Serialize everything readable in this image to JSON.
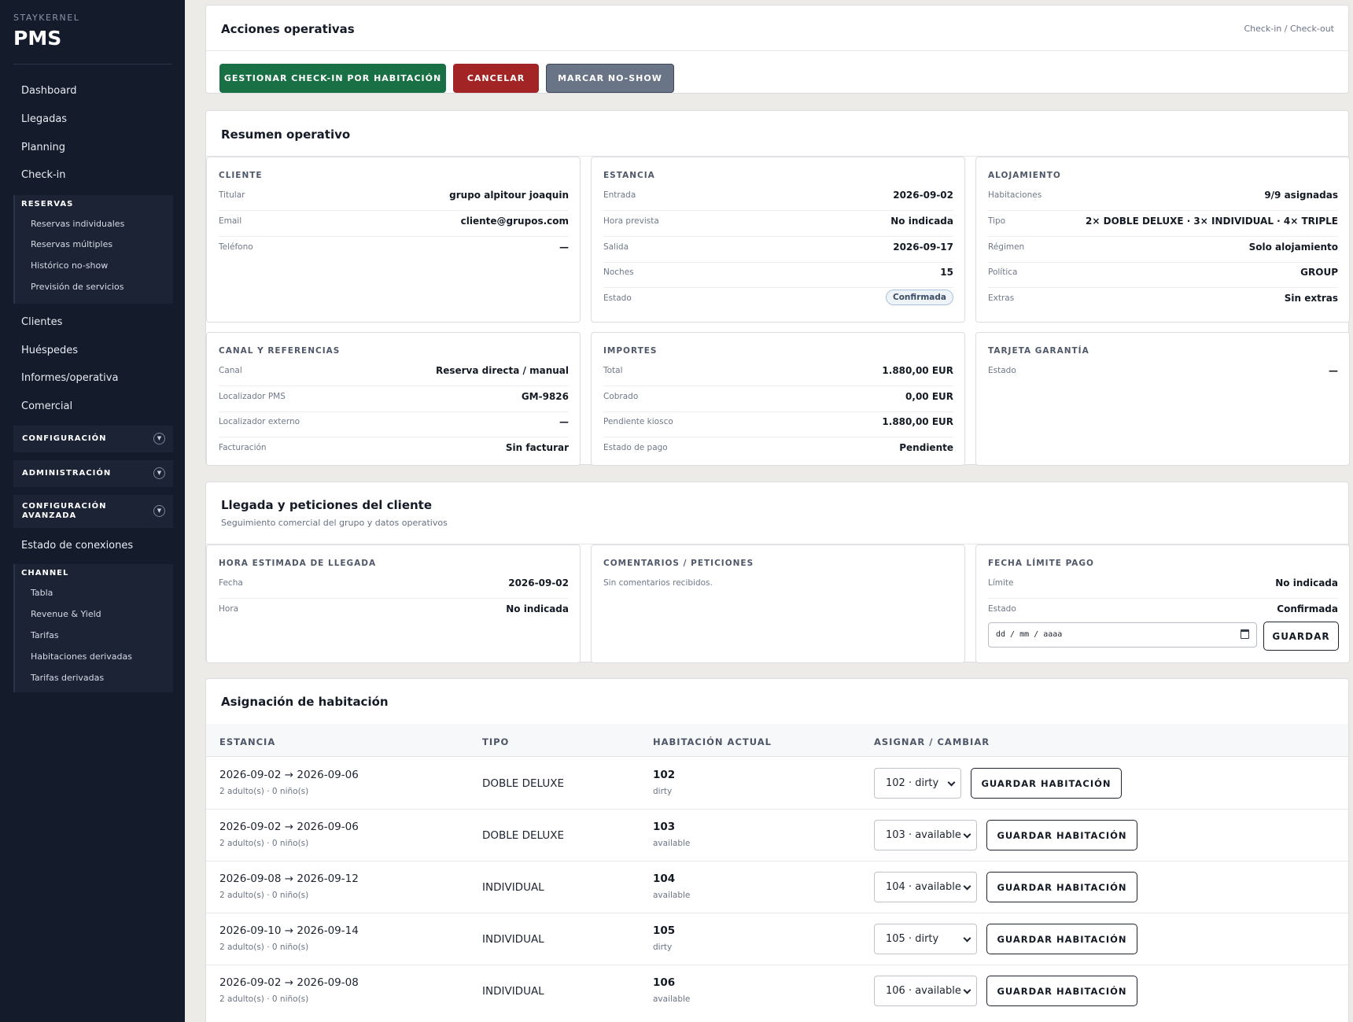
{
  "sidebar": {
    "brand_small": "STAYKERNEL",
    "brand_big": "PMS",
    "items": {
      "dashboard": "Dashboard",
      "llegadas": "Llegadas",
      "planning": "Planning",
      "checkin": "Check-in",
      "clientes": "Clientes",
      "huespedes": "Huéspedes",
      "informes": "Informes/operativa",
      "comercial": "Comercial",
      "estado_conexiones": "Estado de conexiones"
    },
    "reservas": {
      "title": "RESERVAS",
      "items": [
        "Reservas individuales",
        "Reservas múltiples",
        "Histórico no-show",
        "Previsión de servicios"
      ]
    },
    "configuracion": "CONFIGURACIÓN",
    "administracion": "ADMINISTRACIÓN",
    "configuracion_avanzada_1": "CONFIGURACIÓN",
    "configuracion_avanzada_2": "AVANZADA",
    "channel": {
      "title": "CHANNEL",
      "items": [
        "Tabla",
        "Revenue & Yield",
        "Tarifas",
        "Habitaciones derivadas",
        "Tarifas derivadas"
      ]
    }
  },
  "acciones": {
    "title": "Acciones operativas",
    "breadcrumb": "Check-in / Check-out",
    "btn_checkin": "GESTIONAR CHECK-IN POR HABITACIÓN",
    "btn_cancelar": "CANCELAR",
    "btn_noshow": "MARCAR NO-SHOW"
  },
  "resumen": {
    "title": "Resumen operativo",
    "cliente": {
      "title": "CLIENTE",
      "rows": [
        {
          "k": "Titular",
          "v": "grupo alpitour joaquin"
        },
        {
          "k": "Email",
          "v": "cliente@grupos.com"
        },
        {
          "k": "Teléfono",
          "v": "—"
        }
      ]
    },
    "estancia": {
      "title": "ESTANCIA",
      "rows": [
        {
          "k": "Entrada",
          "v": "2026-09-02"
        },
        {
          "k": "Hora prevista",
          "v": "No indicada"
        },
        {
          "k": "Salida",
          "v": "2026-09-17"
        },
        {
          "k": "Noches",
          "v": "15"
        },
        {
          "k": "Estado",
          "v": "Confirmada"
        }
      ]
    },
    "alojamiento": {
      "title": "ALOJAMIENTO",
      "rows": [
        {
          "k": "Habitaciones",
          "v": "9/9 asignadas"
        },
        {
          "k": "Tipo",
          "v": "2× DOBLE DELUXE · 3× INDIVIDUAL · 4× TRIPLE"
        },
        {
          "k": "Régimen",
          "v": "Solo alojamiento"
        },
        {
          "k": "Política",
          "v": "GROUP"
        },
        {
          "k": "Extras",
          "v": "Sin extras"
        }
      ]
    },
    "canal": {
      "title": "CANAL Y REFERENCIAS",
      "rows": [
        {
          "k": "Canal",
          "v": "Reserva directa / manual"
        },
        {
          "k": "Localizador PMS",
          "v": "GM-9826"
        },
        {
          "k": "Localizador externo",
          "v": "—"
        },
        {
          "k": "Facturación",
          "v": "Sin facturar"
        }
      ]
    },
    "importes": {
      "title": "IMPORTES",
      "rows": [
        {
          "k": "Total",
          "v": "1.880,00 EUR"
        },
        {
          "k": "Cobrado",
          "v": "0,00 EUR"
        },
        {
          "k": "Pendiente kiosco",
          "v": "1.880,00 EUR"
        },
        {
          "k": "Estado de pago",
          "v": "Pendiente"
        }
      ]
    },
    "tarjeta": {
      "title": "TARJETA GARANTÍA",
      "rows": [
        {
          "k": "Estado",
          "v": "—"
        }
      ]
    }
  },
  "llegada": {
    "title": "Llegada y peticiones del cliente",
    "subtitle": "Seguimiento comercial del grupo y datos operativos",
    "hora": {
      "title": "HORA ESTIMADA DE LLEGADA",
      "rows": [
        {
          "k": "Fecha",
          "v": "2026-09-02"
        },
        {
          "k": "Hora",
          "v": "No indicada"
        }
      ]
    },
    "comentarios": {
      "title": "COMENTARIOS / PETICIONES",
      "text": "Sin comentarios recibidos."
    },
    "fecha_limite": {
      "title": "FECHA LÍMITE PAGO",
      "rows": [
        {
          "k": "Límite",
          "v": "No indicada"
        },
        {
          "k": "Estado",
          "v": "Confirmada"
        }
      ],
      "date_placeholder": "dd / mm / aaaa",
      "save": "GUARDAR"
    }
  },
  "asignacion": {
    "title": "Asignación de habitación",
    "headers": [
      "ESTANCIA",
      "TIPO",
      "HABITACIÓN ACTUAL",
      "ASIGNAR / CAMBIAR"
    ],
    "save_label": "GUARDAR HABITACIÓN",
    "rows": [
      {
        "stay": "2026-09-02 → 2026-09-06",
        "guests": "2 adulto(s) · 0 niño(s)",
        "type": "DOBLE DELUXE",
        "room": "102",
        "status": "dirty",
        "select": "102 · dirty"
      },
      {
        "stay": "2026-09-02 → 2026-09-06",
        "guests": "2 adulto(s) · 0 niño(s)",
        "type": "DOBLE DELUXE",
        "room": "103",
        "status": "available",
        "select": "103 · available"
      },
      {
        "stay": "2026-09-08 → 2026-09-12",
        "guests": "2 adulto(s) · 0 niño(s)",
        "type": "INDIVIDUAL",
        "room": "104",
        "status": "available",
        "select": "104 · available"
      },
      {
        "stay": "2026-09-10 → 2026-09-14",
        "guests": "2 adulto(s) · 0 niño(s)",
        "type": "INDIVIDUAL",
        "room": "105",
        "status": "dirty",
        "select": "105 · dirty"
      },
      {
        "stay": "2026-09-02 → 2026-09-08",
        "guests": "2 adulto(s) · 0 niño(s)",
        "type": "INDIVIDUAL",
        "room": "106",
        "status": "available",
        "select": "106 · available"
      }
    ]
  }
}
